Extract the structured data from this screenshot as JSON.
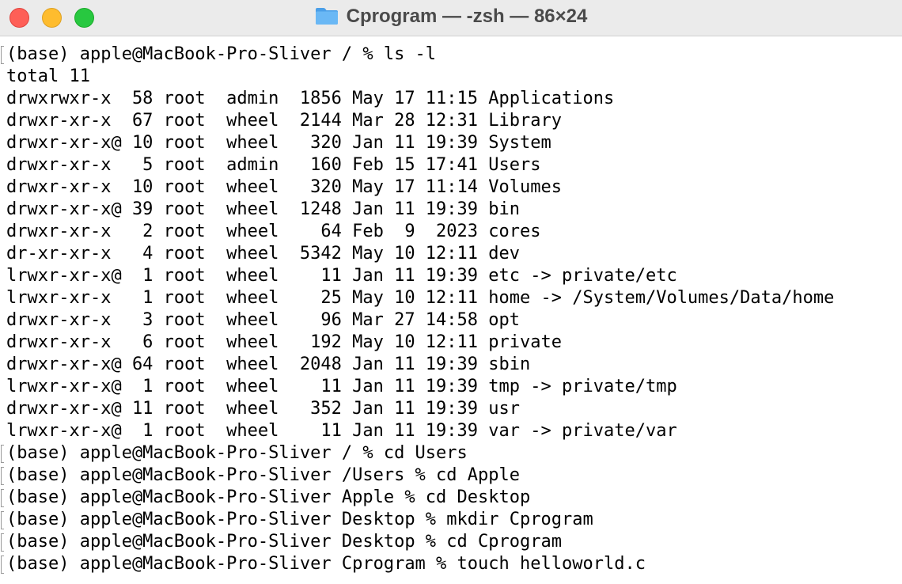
{
  "window": {
    "title": "Cprogram — -zsh — 86×24",
    "title_icon": "folder-icon",
    "colors": {
      "close": "#fe5f57",
      "minimize": "#febc2e",
      "zoom": "#28c840",
      "folder": "#5aacef"
    }
  },
  "terminal": {
    "lines": [
      {
        "text": "(base) apple@MacBook-Pro-Sliver / % ls -l",
        "prompt": true
      },
      {
        "text": "total 11",
        "prompt": false
      },
      {
        "text": "drwxrwxr-x  58 root  admin  1856 May 17 11:15 Applications",
        "prompt": false
      },
      {
        "text": "drwxr-xr-x  67 root  wheel  2144 Mar 28 12:31 Library",
        "prompt": false
      },
      {
        "text": "drwxr-xr-x@ 10 root  wheel   320 Jan 11 19:39 System",
        "prompt": false
      },
      {
        "text": "drwxr-xr-x   5 root  admin   160 Feb 15 17:41 Users",
        "prompt": false
      },
      {
        "text": "drwxr-xr-x  10 root  wheel   320 May 17 11:14 Volumes",
        "prompt": false
      },
      {
        "text": "drwxr-xr-x@ 39 root  wheel  1248 Jan 11 19:39 bin",
        "prompt": false
      },
      {
        "text": "drwxr-xr-x   2 root  wheel    64 Feb  9  2023 cores",
        "prompt": false
      },
      {
        "text": "dr-xr-xr-x   4 root  wheel  5342 May 10 12:11 dev",
        "prompt": false
      },
      {
        "text": "lrwxr-xr-x@  1 root  wheel    11 Jan 11 19:39 etc -> private/etc",
        "prompt": false
      },
      {
        "text": "lrwxr-xr-x   1 root  wheel    25 May 10 12:11 home -> /System/Volumes/Data/home",
        "prompt": false
      },
      {
        "text": "drwxr-xr-x   3 root  wheel    96 Mar 27 14:58 opt",
        "prompt": false
      },
      {
        "text": "drwxr-xr-x   6 root  wheel   192 May 10 12:11 private",
        "prompt": false
      },
      {
        "text": "drwxr-xr-x@ 64 root  wheel  2048 Jan 11 19:39 sbin",
        "prompt": false
      },
      {
        "text": "lrwxr-xr-x@  1 root  wheel    11 Jan 11 19:39 tmp -> private/tmp",
        "prompt": false
      },
      {
        "text": "drwxr-xr-x@ 11 root  wheel   352 Jan 11 19:39 usr",
        "prompt": false
      },
      {
        "text": "lrwxr-xr-x@  1 root  wheel    11 Jan 11 19:39 var -> private/var",
        "prompt": false
      },
      {
        "text": "(base) apple@MacBook-Pro-Sliver / % cd Users",
        "prompt": true
      },
      {
        "text": "(base) apple@MacBook-Pro-Sliver /Users % cd Apple",
        "prompt": true
      },
      {
        "text": "(base) apple@MacBook-Pro-Sliver Apple % cd Desktop",
        "prompt": true
      },
      {
        "text": "(base) apple@MacBook-Pro-Sliver Desktop % mkdir Cprogram",
        "prompt": true
      },
      {
        "text": "(base) apple@MacBook-Pro-Sliver Desktop % cd Cprogram",
        "prompt": true
      },
      {
        "text": "(base) apple@MacBook-Pro-Sliver Cprogram % touch helloworld.c",
        "prompt": true
      }
    ]
  }
}
